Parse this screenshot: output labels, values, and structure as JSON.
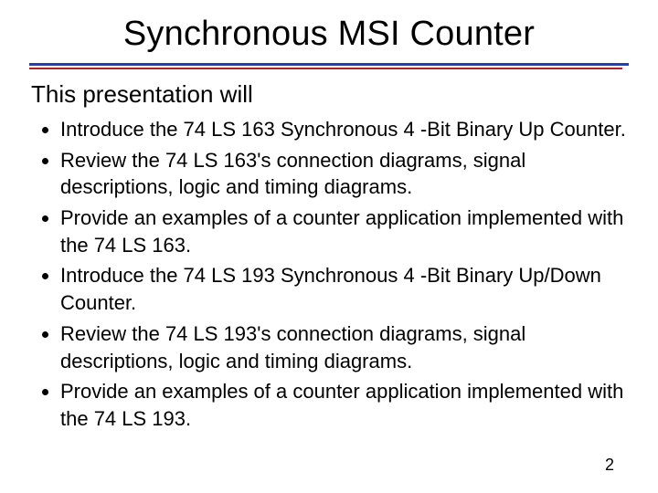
{
  "title": "Synchronous MSI Counter",
  "subtitle": "This presentation will",
  "bullets": [
    "Introduce the 74 LS 163 Synchronous 4 -Bit Binary Up Counter.",
    "Review the 74 LS 163's connection diagrams, signal descriptions, logic and timing diagrams.",
    "Provide an examples of a counter application implemented with the 74 LS 163.",
    "Introduce the 74 LS 193 Synchronous 4 -Bit Binary Up/Down Counter.",
    "Review the 74 LS 193's connection diagrams, signal descriptions, logic and timing diagrams.",
    "Provide an examples of a counter application implemented with the 74 LS 193."
  ],
  "page_number": "2"
}
